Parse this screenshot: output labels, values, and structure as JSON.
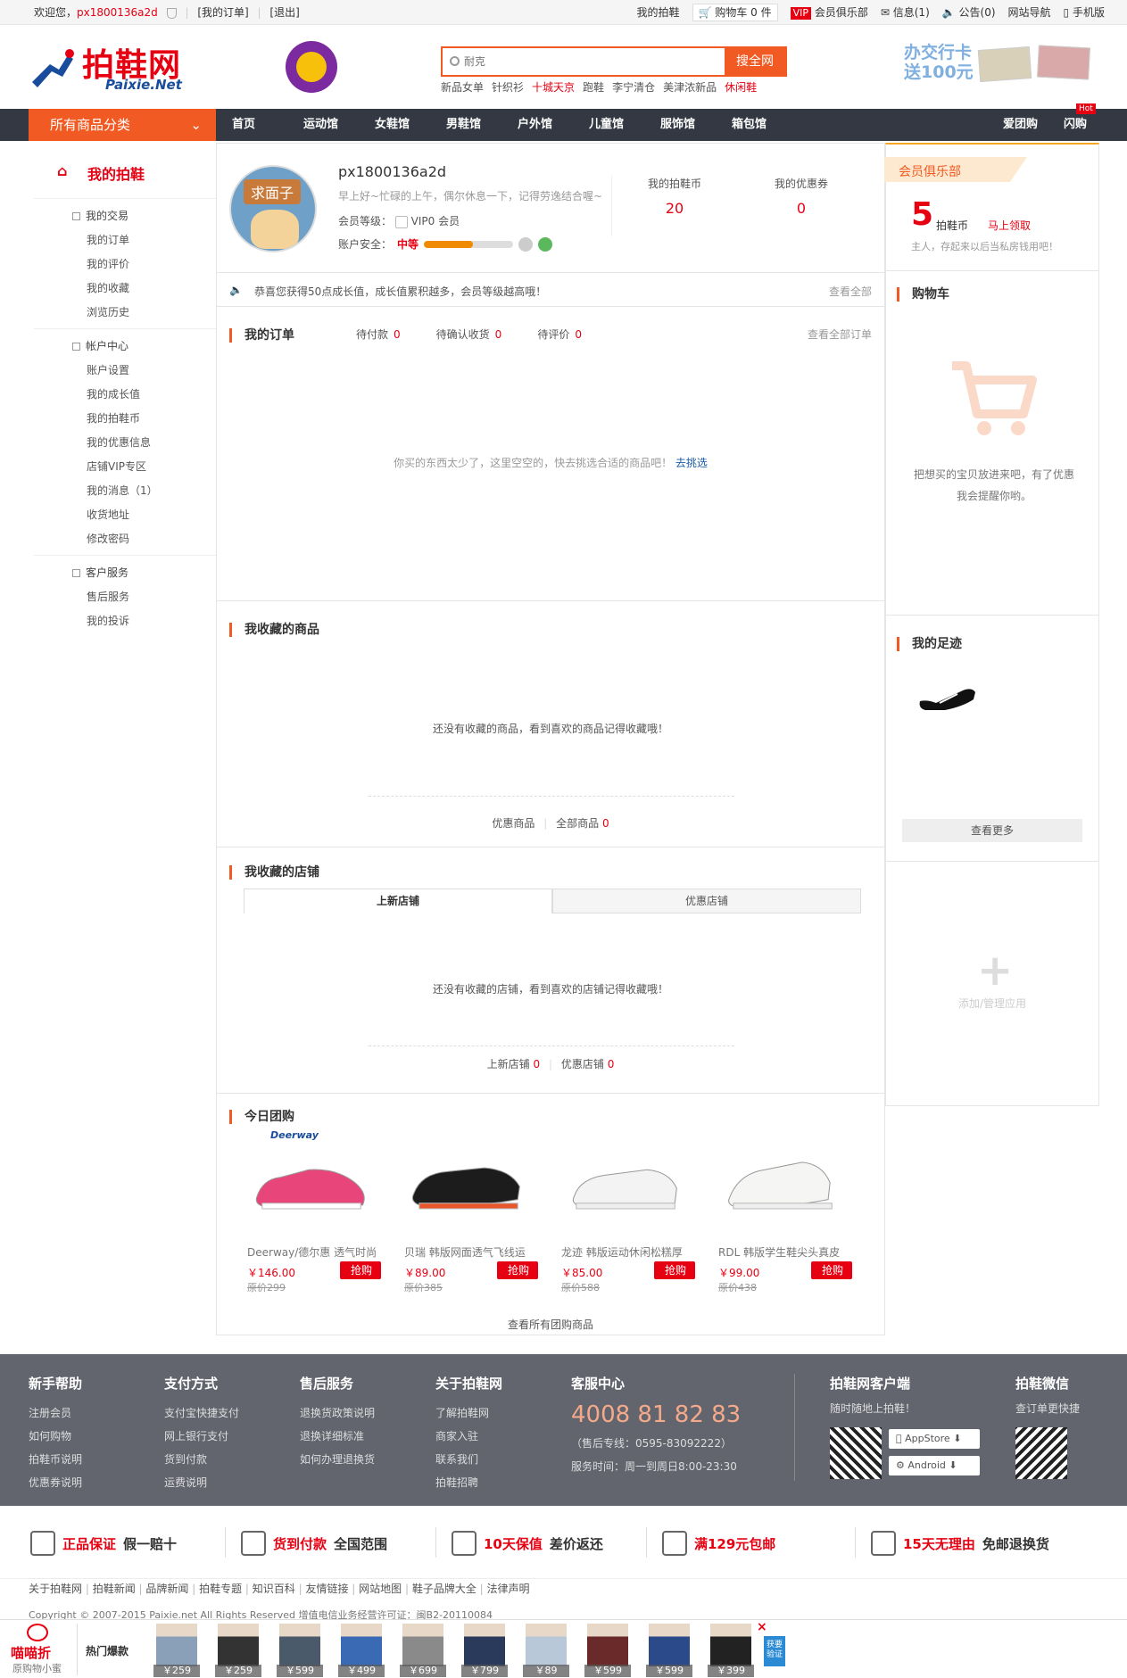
{
  "topbar": {
    "welcome": "欢迎您，",
    "username": "px1800136a2d",
    "my_order": "[我的订单]",
    "logout": "[退出]",
    "my_paixie": "我的拍鞋",
    "cart": "购物车 0 件",
    "vip_badge": "VIP",
    "vip_club": "会员俱乐部",
    "messages": "信息(1)",
    "notice": "公告(0)",
    "site_nav": "网站导航",
    "mobile": "手机版"
  },
  "header": {
    "logo_cn": "拍鞋网",
    "logo_en": "Paixie.Net",
    "search_placeholder": "耐克",
    "search_button": "搜全网",
    "hot_words": [
      "新品女单",
      "针织衫",
      "十城天京",
      "跑鞋",
      "李宁清仓",
      "美津浓新品",
      "休闲鞋"
    ],
    "hot_red_indices": [
      2,
      6
    ],
    "promo_text": "办交行卡\n送100元"
  },
  "nav": {
    "category": "所有商品分类",
    "items": [
      "首页",
      "运动馆",
      "女鞋馆",
      "男鞋馆",
      "户外馆",
      "儿童馆",
      "服饰馆",
      "箱包馆"
    ],
    "right": [
      "爱团购",
      "闪购"
    ],
    "hot_badge": "Hot"
  },
  "sidebar": {
    "title": "我的拍鞋",
    "groups": [
      {
        "title": "我的交易",
        "items": [
          "我的订单",
          "我的评价",
          "我的收藏",
          "浏览历史"
        ]
      },
      {
        "title": "帐户中心",
        "items": [
          "账户设置",
          "我的成长值",
          "我的拍鞋币",
          "我的优惠信息",
          "店铺VIP专区",
          "我的消息（1）",
          "收货地址",
          "修改密码"
        ]
      },
      {
        "title": "客户服务",
        "items": [
          "售后服务",
          "我的投诉"
        ]
      }
    ]
  },
  "profile": {
    "avatar_text": "求面子",
    "username": "px1800136a2d",
    "greeting": "早上好~忙碌的上午，偶尔休息一下，记得劳逸结合喔~",
    "level_label": "会员等级：",
    "level_value": "VIP0 会员",
    "security_label": "账户安全：",
    "security_value": "中等",
    "security_progress": 0.55,
    "coins_label": "我的拍鞋币",
    "coins_value": "20",
    "coupons_label": "我的优惠券",
    "coupons_value": "0",
    "notice": "恭喜您获得50点成长值，成长值累积越多，会员等级越高哦！",
    "view_all": "查看全部"
  },
  "club": {
    "title": "会员俱乐部",
    "coin_num": "5",
    "coin_unit": "拍鞋币",
    "claim": "马上领取",
    "tip": "主人，存起来以后当私房钱用吧！"
  },
  "orders": {
    "title": "我的订单",
    "tabs": [
      "待付款",
      "待确认收货",
      "待评价"
    ],
    "counts": [
      "0",
      "0",
      "0"
    ],
    "view_all": "查看全部订单",
    "empty": "你买的东西太少了，这里空空的，快去挑选合适的商品吧！",
    "go_pick": "去挑选"
  },
  "cart_panel": {
    "title": "购物车",
    "empty": "把想买的宝贝放进来吧，有了优惠我会提醒你哟。"
  },
  "fav_goods": {
    "title": "我收藏的商品",
    "empty": "还没有收藏的商品，看到喜欢的商品记得收藏哦！",
    "tab1": "优惠商品",
    "tab2": "全部商品",
    "tab2_count": "0"
  },
  "footprint": {
    "title": "我的足迹",
    "more": "查看更多"
  },
  "fav_shops": {
    "title": "我收藏的店铺",
    "tab_new": "上新店铺",
    "tab_deal": "优惠店铺",
    "empty": "还没有收藏的店铺，看到喜欢的店铺记得收藏哦！",
    "bottom1": "上新店铺",
    "bottom1_count": "0",
    "bottom2": "优惠店铺",
    "bottom2_count": "0"
  },
  "add_app": {
    "label": "添加/管理应用"
  },
  "group_buy": {
    "title": "今日团购",
    "view_all": "查看所有团购商品",
    "products": [
      {
        "brand": "Deerway",
        "name": "Deerway/德尔惠 透气时尚",
        "price": "￥146.00",
        "orig": "原价299",
        "btn": "抢购",
        "color": "#e8457a"
      },
      {
        "brand": "",
        "name": "贝瑞 韩版网面透气飞线运",
        "price": "￥89.00",
        "orig": "原价385",
        "btn": "抢购",
        "color": "#1c1c1c"
      },
      {
        "brand": "",
        "name": "龙迹 韩版运动休闲松糕厚",
        "price": "￥85.00",
        "orig": "原价588",
        "btn": "抢购",
        "color": "#f3f3f3"
      },
      {
        "brand": "",
        "name": "RDL 韩版学生鞋尖头真皮",
        "price": "￥99.00",
        "orig": "原价438",
        "btn": "抢购",
        "color": "#f5f5f3"
      }
    ]
  },
  "footer": {
    "cols": [
      {
        "title": "新手帮助",
        "items": [
          "注册会员",
          "如何购物",
          "拍鞋币说明",
          "优惠券说明"
        ]
      },
      {
        "title": "支付方式",
        "items": [
          "支付宝快捷支付",
          "网上银行支付",
          "货到付款",
          "运费说明"
        ]
      },
      {
        "title": "售后服务",
        "items": [
          "退换货政策说明",
          "退换详细标准",
          "如何办理退换货"
        ]
      },
      {
        "title": "关于拍鞋网",
        "items": [
          "了解拍鞋网",
          "商家入驻",
          "联系我们",
          "拍鞋招聘"
        ]
      }
    ],
    "service_title": "客服中心",
    "phone": "4008 81 82 83",
    "after_sale": "（售后专线：0595-83092222）",
    "hours": "服务时间：周一到周日8:00-23:30",
    "app_title": "拍鞋网客户端",
    "app_sub": "随时随地上拍鞋！",
    "appstore": "AppStore",
    "android": "Android",
    "wx_title": "拍鞋微信",
    "wx_sub": "查订单更快捷"
  },
  "guarantees": [
    {
      "red": "正品保证",
      "black": "假一赔十"
    },
    {
      "red": "货到付款",
      "black": "全国范围"
    },
    {
      "red": "10天保值",
      "black": "差价返还"
    },
    {
      "red": "满129元包邮",
      "black": ""
    },
    {
      "red": "15天无理由",
      "black": "免邮退换货"
    }
  ],
  "bottom_links": [
    "关于拍鞋网",
    "拍鞋新闻",
    "品牌新闻",
    "拍鞋专题",
    "知识百科",
    "友情链接",
    "网站地图",
    "鞋子品牌大全",
    "法律声明"
  ],
  "copyright": "Copyright © 2007-2015 Paixie.net All Rights Reserved 增值电信业务经营许可证：闽B2-20110084",
  "bottom_bar": {
    "logo": "喵喵折",
    "logo_sub": "原购物小蜜",
    "hot": "热门爆款",
    "prices": [
      "￥259",
      "￥259",
      "￥599",
      "￥499",
      "￥699",
      "￥799",
      "￥89",
      "￥599",
      "￥599",
      "￥399"
    ],
    "close": "×",
    "verify": "获要验证"
  }
}
